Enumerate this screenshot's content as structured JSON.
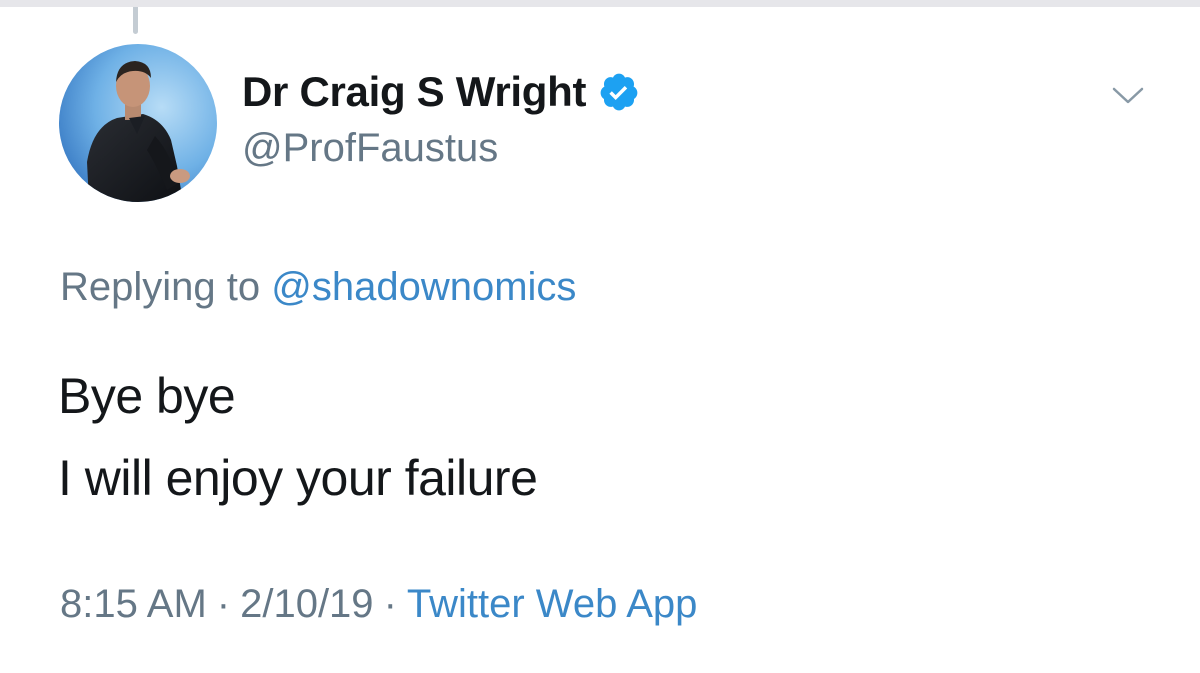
{
  "author": {
    "display_name": "Dr Craig S Wright",
    "handle": "@ProfFaustus",
    "verified": true
  },
  "reply": {
    "prefix": "Replying to",
    "handle": "@shadownomics"
  },
  "tweet": {
    "lines": [
      "Bye bye",
      "I will enjoy your failure"
    ]
  },
  "meta": {
    "time": "8:15 AM",
    "separator": "·",
    "date": "2/10/19",
    "source": "Twitter Web App"
  },
  "icons": {
    "verified": "verified-badge-icon",
    "caret": "chevron-down-icon"
  },
  "colors": {
    "text_primary": "#14171a",
    "text_secondary": "#657786",
    "link": "#3b88c8",
    "verified_badge": "#1da1f2"
  }
}
